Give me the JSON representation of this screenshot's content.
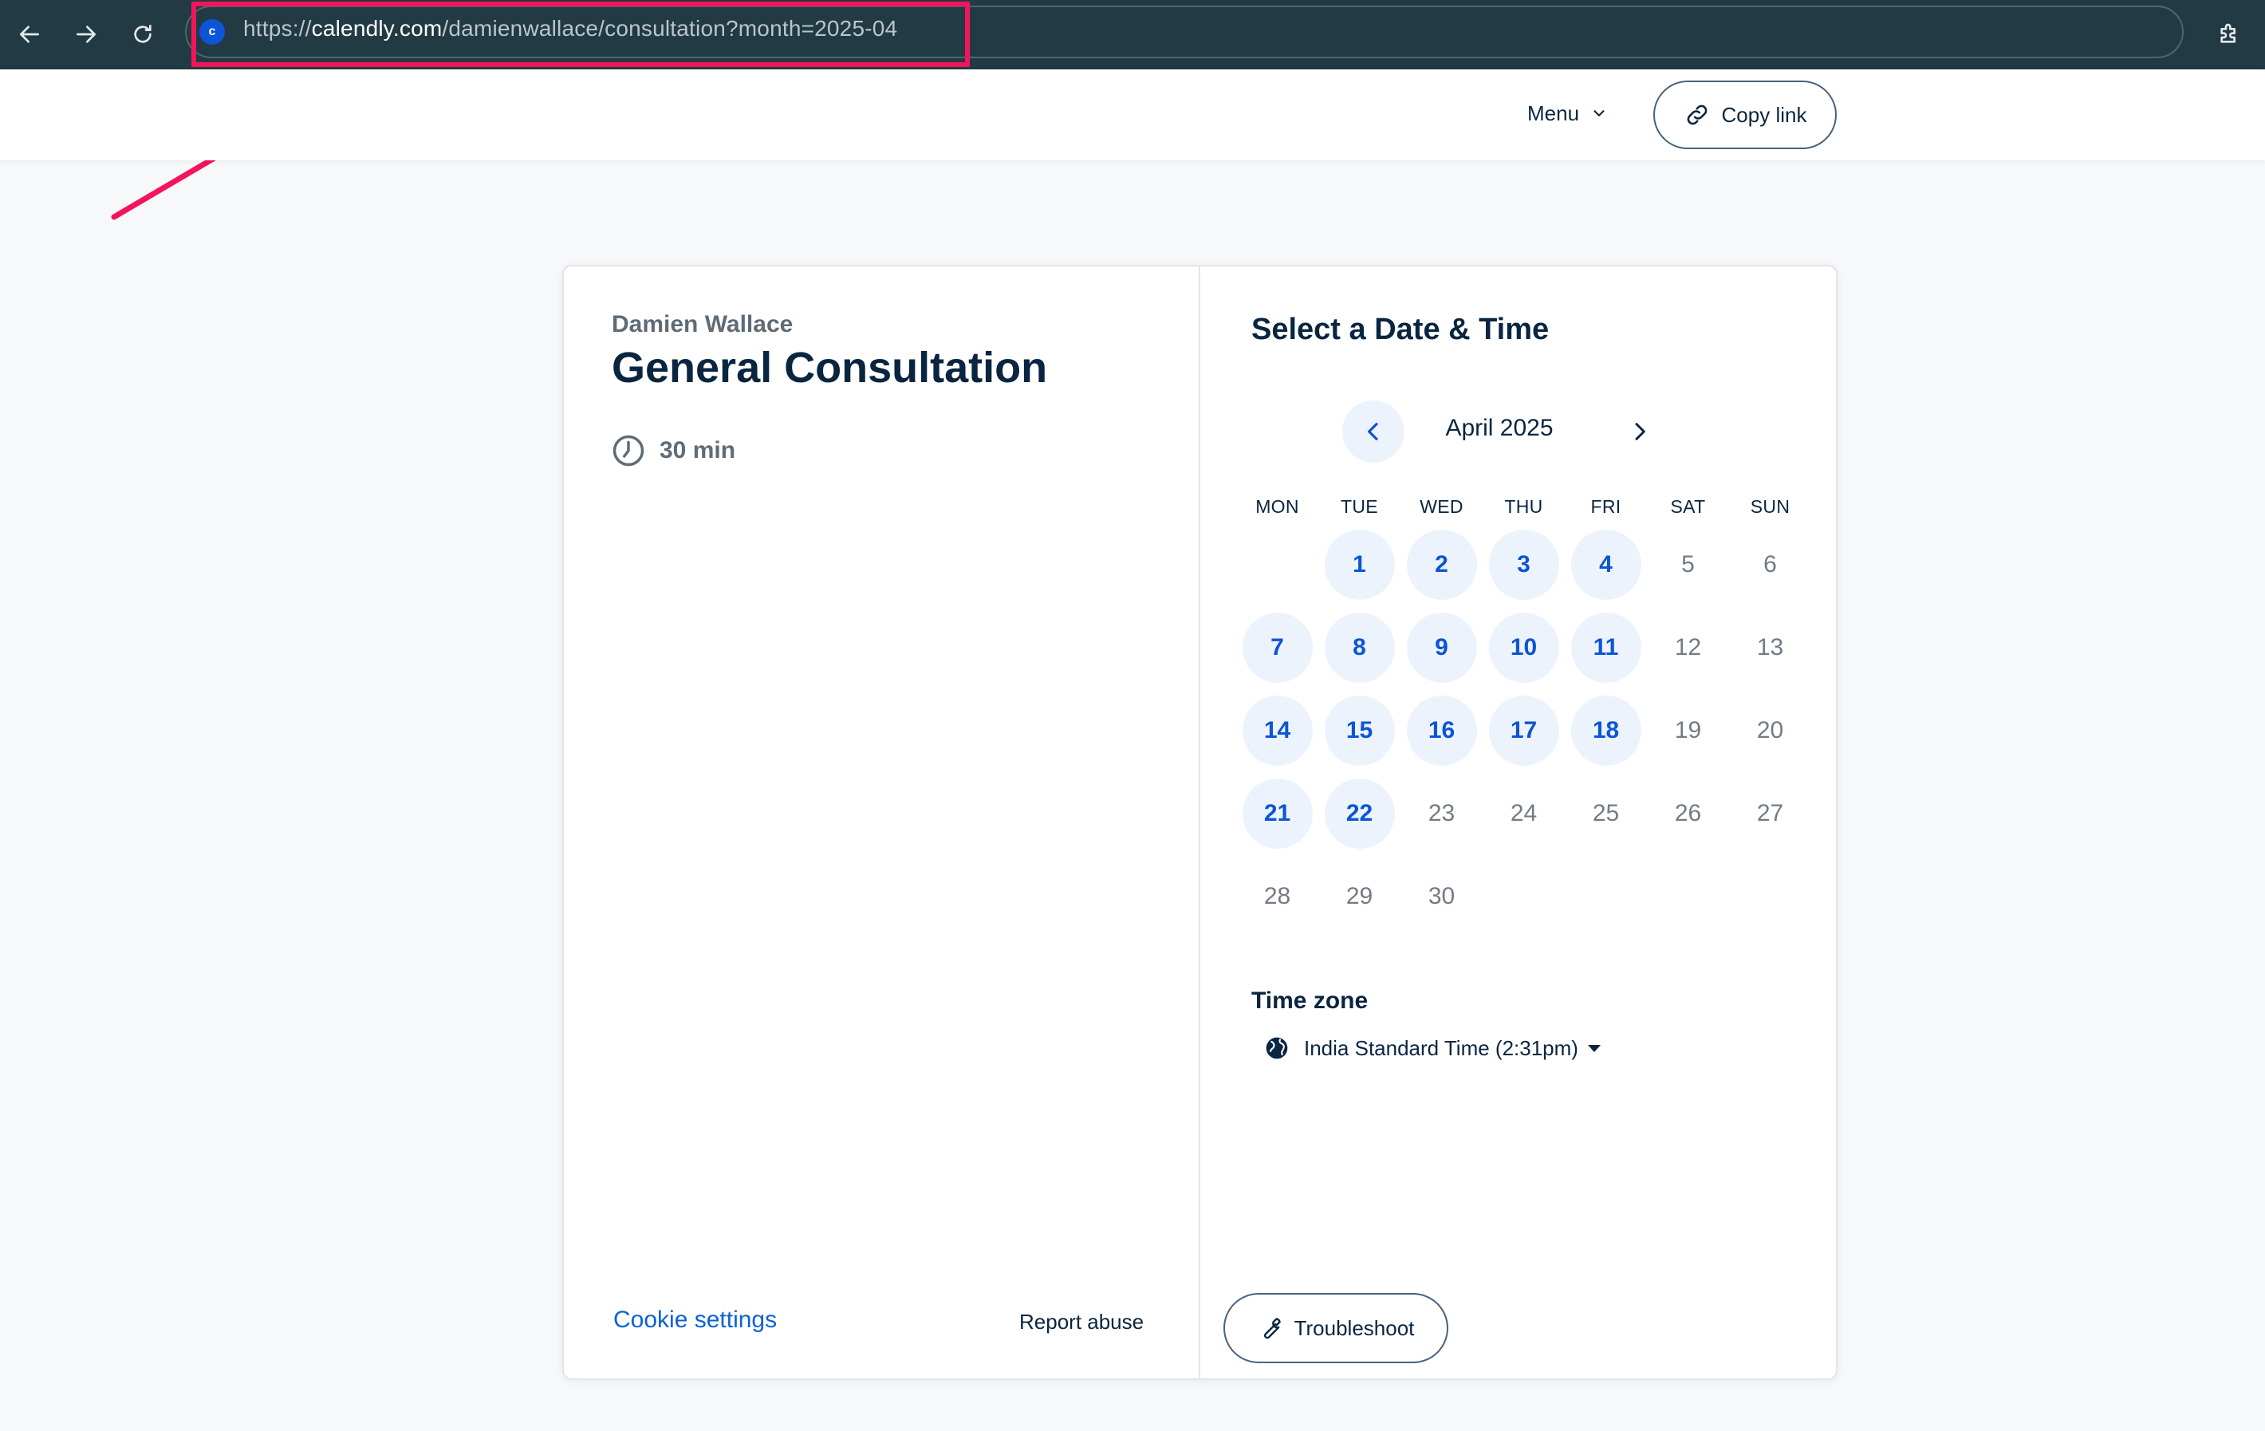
{
  "browser": {
    "url_scheme": "https://",
    "url_host": "calendly.com",
    "url_path": "/damienwallace/consultation?month=2025-04",
    "icons": [
      "back-arrow-icon",
      "forward-arrow-icon",
      "reload-icon",
      "extensions-icon"
    ],
    "highlight_color": "#f4145a"
  },
  "header": {
    "menu_label": "Menu",
    "copy_link_label": "Copy link"
  },
  "event": {
    "organizer": "Damien Wallace",
    "title": "General Consultation",
    "duration": "30 min"
  },
  "scheduler": {
    "heading": "Select a Date & Time",
    "month_label": "April 2025",
    "weekdays": [
      "MON",
      "TUE",
      "WED",
      "THU",
      "FRI",
      "SAT",
      "SUN"
    ],
    "first_weekday_offset": 1,
    "days": [
      {
        "d": "1",
        "available": true
      },
      {
        "d": "2",
        "available": true
      },
      {
        "d": "3",
        "available": true
      },
      {
        "d": "4",
        "available": true
      },
      {
        "d": "5",
        "available": false
      },
      {
        "d": "6",
        "available": false
      },
      {
        "d": "7",
        "available": true
      },
      {
        "d": "8",
        "available": true
      },
      {
        "d": "9",
        "available": true
      },
      {
        "d": "10",
        "available": true
      },
      {
        "d": "11",
        "available": true
      },
      {
        "d": "12",
        "available": false
      },
      {
        "d": "13",
        "available": false
      },
      {
        "d": "14",
        "available": true
      },
      {
        "d": "15",
        "available": true
      },
      {
        "d": "16",
        "available": true
      },
      {
        "d": "17",
        "available": true
      },
      {
        "d": "18",
        "available": true
      },
      {
        "d": "19",
        "available": false
      },
      {
        "d": "20",
        "available": false
      },
      {
        "d": "21",
        "available": true
      },
      {
        "d": "22",
        "available": true
      },
      {
        "d": "23",
        "available": false
      },
      {
        "d": "24",
        "available": false
      },
      {
        "d": "25",
        "available": false
      },
      {
        "d": "26",
        "available": false
      },
      {
        "d": "27",
        "available": false
      },
      {
        "d": "28",
        "available": false
      },
      {
        "d": "29",
        "available": false
      },
      {
        "d": "30",
        "available": false
      }
    ],
    "timezone_label": "Time zone",
    "timezone_value": "India Standard Time (2:31pm)",
    "accent_color": "#0b55d6"
  },
  "footer": {
    "cookie_settings": "Cookie settings",
    "report_abuse": "Report abuse",
    "troubleshoot": "Troubleshoot"
  }
}
